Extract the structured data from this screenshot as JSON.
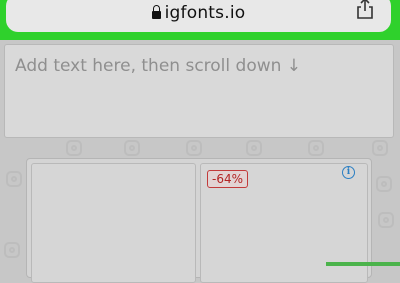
{
  "browser": {
    "url": "igfonts.io"
  },
  "editor": {
    "placeholder": "Add text here, then scroll down ↓"
  },
  "preview": {
    "discount_badge": "-64%",
    "info_symbol": "i"
  },
  "colors": {
    "highlight": "#2fd12c",
    "badge": "#b32424",
    "info": "#2b7fc3"
  },
  "icons": [
    "lock-icon",
    "share-icon",
    "info-icon",
    "instagram-icon"
  ]
}
